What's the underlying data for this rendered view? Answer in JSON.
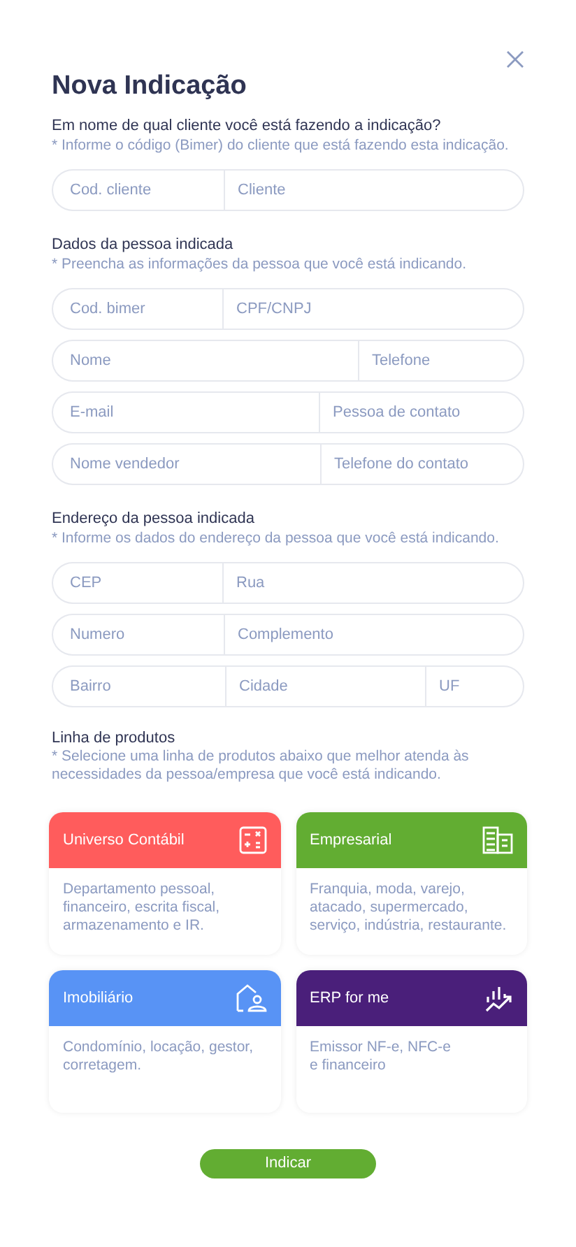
{
  "title": "Nova Indicação",
  "sections": [
    {
      "heading": "Em nome de qual cliente você está fazendo a indicação?",
      "hint": "* Informe o código (Bimer) do cliente que está fazendo esta indicação.",
      "rows": [
        [
          {
            "placeholder": "Cod. cliente"
          },
          {
            "placeholder": "Cliente"
          }
        ]
      ]
    },
    {
      "heading": "Dados da pessoa indicada",
      "hint": "* Preencha as informações da pessoa que você está indicando.",
      "rows": [
        [
          {
            "placeholder": "Cod. bimer"
          },
          {
            "placeholder": "CPF/CNPJ"
          }
        ],
        [
          {
            "placeholder": "Nome"
          },
          {
            "placeholder": "Telefone"
          }
        ],
        [
          {
            "placeholder": "E-mail"
          },
          {
            "placeholder": "Pessoa de contato"
          }
        ],
        [
          {
            "placeholder": "Nome vendedor"
          },
          {
            "placeholder": "Telefone do contato"
          }
        ]
      ]
    },
    {
      "heading": "Endereço da pessoa indicada",
      "hint": "* Informe os dados do endereço da pessoa que você está indicando.",
      "rows": [
        [
          {
            "placeholder": "CEP"
          },
          {
            "placeholder": "Rua"
          }
        ],
        [
          {
            "placeholder": "Numero"
          },
          {
            "placeholder": "Complemento"
          }
        ],
        [
          {
            "placeholder": "Bairro"
          },
          {
            "placeholder": "Cidade"
          },
          {
            "placeholder": "UF"
          }
        ]
      ]
    }
  ],
  "products": {
    "heading": "Linha de produtos",
    "hint": "* Selecione uma linha de produtos abaixo que melhor atenda às necessidades da pessoa/empresa que você está indicando.",
    "cards": [
      {
        "title": "Universo Contábil",
        "kind": "calculator",
        "color": "#ff5c5c",
        "description": "Departamento pessoal, financeiro, escrita fiscal, armazenamento e IR."
      },
      {
        "title": "Empresarial",
        "kind": "building",
        "color": "#62ad32",
        "description": "Franquia, moda, varejo, atacado, supermercado, serviço, indústria, restaurante."
      },
      {
        "title": "Imobiliário",
        "kind": "house",
        "color": "#5893f5",
        "description": "Condomínio, locação, gestor, corretagem."
      },
      {
        "title": "ERP for me",
        "kind": "chart",
        "color": "#4a1f7a",
        "description": "Emissor NF-e, NFC-e\ne financeiro"
      }
    ]
  },
  "submit": "Indicar"
}
